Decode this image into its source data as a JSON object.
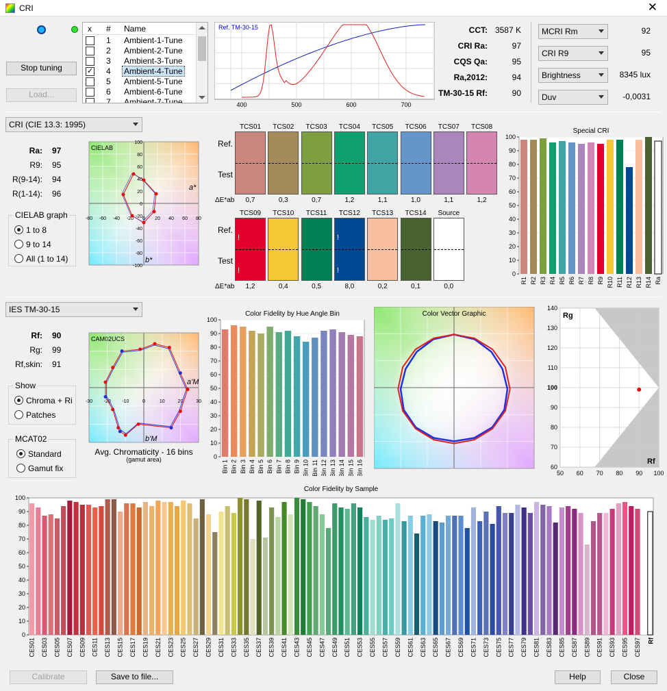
{
  "window": {
    "title": "CRI",
    "close": "✕"
  },
  "top": {
    "stop_tuning": "Stop tuning",
    "load": "Load...",
    "list_headers": [
      "x",
      "#",
      "Name"
    ],
    "list": [
      {
        "n": "1",
        "name": "Ambient-1-Tune",
        "checked": false
      },
      {
        "n": "2",
        "name": "Ambient-2-Tune",
        "checked": false
      },
      {
        "n": "3",
        "name": "Ambient-3-Tune",
        "checked": false
      },
      {
        "n": "4",
        "name": "Ambient-4-Tune",
        "checked": true,
        "selected": true
      },
      {
        "n": "5",
        "name": "Ambient-5-Tune",
        "checked": false
      },
      {
        "n": "6",
        "name": "Ambient-6-Tune",
        "checked": false
      },
      {
        "n": "7",
        "name": "Ambient-7-Tune",
        "checked": false
      }
    ],
    "spectrum_label": "Ref. TM-30-15",
    "spectrum_ticks": [
      "400",
      "500",
      "600",
      "700"
    ],
    "metrics": [
      {
        "label": "CCT:",
        "value": "3587 K"
      },
      {
        "label": "CRI Ra:",
        "value": "97"
      },
      {
        "label": "CQS Qa:",
        "value": "95"
      },
      {
        "label": "Ra,2012:",
        "value": "94"
      },
      {
        "label": "TM-30-15 Rf:",
        "value": "90"
      }
    ],
    "drop_metrics": [
      {
        "label": "MCRI Rm",
        "value": "92"
      },
      {
        "label": "CRI R9",
        "value": "95"
      },
      {
        "label": "Brightness",
        "value": "8345 lux"
      },
      {
        "label": "Duv",
        "value": "-0,0031"
      }
    ]
  },
  "cri": {
    "mode": "CRI (CIE 13.3: 1995)",
    "rows": [
      {
        "label": "Ra:",
        "value": "97"
      },
      {
        "label": "R9:",
        "value": "95"
      },
      {
        "label": "R(9-14):",
        "value": "94"
      },
      {
        "label": "R(1-14):",
        "value": "96"
      }
    ],
    "graph_title": "CIELAB graph",
    "radios": [
      "1 to 8",
      "9 to 14",
      "All (1 to 14)"
    ],
    "radio_selected": 0,
    "plot_label": "CIELAB",
    "axis_a": "a*",
    "axis_b": "b*",
    "plot_ticks": [
      "-80",
      "-60",
      "-40",
      "-20",
      "0",
      "20",
      "40",
      "60",
      "80"
    ],
    "plot_yticks": [
      "100",
      "80",
      "60",
      "40",
      "20",
      "0",
      "-20",
      "-40",
      "-60",
      "-80",
      "-100"
    ],
    "ref_label": "Ref.",
    "test_label": "Test",
    "de_label": "ΔE*ab",
    "tcs_row1": [
      {
        "name": "TCS01",
        "de": "0,7",
        "color": "#c9877e"
      },
      {
        "name": "TCS02",
        "de": "0,3",
        "color": "#a58b5a"
      },
      {
        "name": "TCS03",
        "de": "0,7",
        "color": "#7e9e42"
      },
      {
        "name": "TCS04",
        "de": "1,2",
        "color": "#0fa071"
      },
      {
        "name": "TCS05",
        "de": "1,1",
        "color": "#3ea4a4"
      },
      {
        "name": "TCS06",
        "de": "1,0",
        "color": "#6496cc"
      },
      {
        "name": "TCS07",
        "de": "1,1",
        "color": "#ab86bc"
      },
      {
        "name": "TCS08",
        "de": "1,2",
        "color": "#d585b2"
      }
    ],
    "tcs_row2": [
      {
        "name": "TCS09",
        "de": "1,2",
        "color": "#e4002a",
        "mark": true
      },
      {
        "name": "TCS10",
        "de": "0,4",
        "color": "#f3c834"
      },
      {
        "name": "TCS11",
        "de": "0,5",
        "color": "#008057"
      },
      {
        "name": "TCS12",
        "de": "8,0",
        "color": "#004a94",
        "mark": true
      },
      {
        "name": "TCS13",
        "de": "0,2",
        "color": "#f8c0a0"
      },
      {
        "name": "TCS14",
        "de": "0,1",
        "color": "#486230"
      },
      {
        "name": "Source",
        "de": "0,0",
        "color": "#ffffff"
      }
    ],
    "special_title": "Special CRI",
    "special": {
      "labels": [
        "R1",
        "R2",
        "R3",
        "R4",
        "R5",
        "R6",
        "R7",
        "R8",
        "R9",
        "R10",
        "R11",
        "R12",
        "R13",
        "R14",
        "Ra"
      ],
      "values": [
        98,
        98,
        99,
        96,
        97,
        96,
        95,
        96,
        95,
        98,
        98,
        78,
        98,
        100,
        97
      ],
      "colors": [
        "#c9877e",
        "#a58b5a",
        "#7e9e42",
        "#0fa071",
        "#3ea4a4",
        "#6496cc",
        "#ab86bc",
        "#d585b2",
        "#e4002a",
        "#f3c834",
        "#008057",
        "#004a94",
        "#f8c0a0",
        "#486230",
        "#ffffff"
      ],
      "ylim": [
        0,
        100
      ],
      "yticks": [
        "0",
        "10",
        "20",
        "30",
        "40",
        "50",
        "60",
        "70",
        "80",
        "90",
        "100"
      ]
    }
  },
  "tm30": {
    "mode": "IES TM-30-15",
    "rows": [
      {
        "label": "Rf:",
        "value": "90"
      },
      {
        "label": "Rg:",
        "value": "99"
      },
      {
        "label": "Rf,skin:",
        "value": "91"
      }
    ],
    "show_title": "Show",
    "show_radios": [
      "Chroma + Ri",
      "Patches"
    ],
    "show_selected": 0,
    "mcat_title": "MCAT02",
    "mcat_radios": [
      "Standard",
      "Gamut fix"
    ],
    "mcat_selected": 0,
    "plot_label": "CAM02UCS",
    "axis_a": "a'M",
    "axis_b": "b'M",
    "plot_ticks": [
      "-30",
      "-20",
      "-10",
      "0",
      "10",
      "20",
      "30"
    ],
    "plot_caption": "Avg. Chromaticity - 16 bins",
    "plot_sub": "(gamut area)",
    "hue_title": "Color Fidelity by Hue Angle Bin",
    "hue": {
      "labels": [
        "Bin 1",
        "Bin 2",
        "Bin 3",
        "Bin 4",
        "Bin 5",
        "Bin 6",
        "Bin 7",
        "Bin 8",
        "Bin 9",
        "Bin 10",
        "Bin 11",
        "Bin 12",
        "Bin 13",
        "Bin 14",
        "Bin 15",
        "Bin 16"
      ],
      "values": [
        93,
        96,
        95,
        92,
        90,
        95,
        91,
        92,
        88,
        84,
        87,
        92,
        93,
        91,
        89,
        88
      ],
      "colors": [
        "#e07a6a",
        "#e98a5e",
        "#e8a059",
        "#c7a35a",
        "#a9ab63",
        "#7fae6e",
        "#58ab82",
        "#40a996",
        "#44a6ab",
        "#4a9cbc",
        "#5e8fbf",
        "#7a86c0",
        "#8f80bb",
        "#a47ab0",
        "#b777a3",
        "#c77689"
      ],
      "ylim": [
        0,
        100
      ],
      "yticks": [
        "0",
        "10",
        "20",
        "30",
        "40",
        "50",
        "60",
        "70",
        "80",
        "90",
        "100"
      ]
    },
    "cvg_title": "Color Vector Graphic",
    "rfrg": {
      "rg_label": "Rg",
      "rf_label": "Rf",
      "yticks": [
        "140",
        "130",
        "120",
        "110",
        "100",
        "90",
        "80",
        "70",
        "60"
      ],
      "xticks": [
        "50",
        "60",
        "70",
        "80",
        "90",
        "100"
      ],
      "point_rf": 90,
      "point_rg": 99
    }
  },
  "samples": {
    "title": "Color Fidelity by Sample",
    "yticks": [
      "0",
      "10",
      "20",
      "30",
      "40",
      "50",
      "60",
      "70",
      "80",
      "90",
      "100"
    ],
    "rf_label": "Rf",
    "values": [
      96,
      93,
      87,
      88,
      85,
      94,
      98,
      97,
      95,
      95,
      93,
      94,
      99,
      99,
      90,
      96,
      96,
      93,
      97,
      94,
      98,
      97,
      97,
      94,
      98,
      96,
      85,
      99,
      88,
      75,
      90,
      94,
      89,
      100,
      99,
      70,
      98,
      71,
      93,
      86,
      97,
      88,
      100,
      99,
      97,
      94,
      88,
      78,
      96,
      93,
      92,
      96,
      93,
      86,
      84,
      87,
      84,
      85,
      96,
      83,
      87,
      74,
      87,
      88,
      83,
      82,
      87,
      87,
      87,
      78,
      93,
      83,
      90,
      81,
      94,
      89,
      89,
      95,
      93,
      89,
      97,
      95,
      94,
      82,
      93,
      94,
      92,
      89,
      66,
      83,
      89,
      89,
      92,
      96,
      97,
      94,
      92,
      91
    ],
    "colors": [
      "#f09aa8",
      "#e77f94",
      "#d85a72",
      "#d9707a",
      "#c95a68",
      "#c44d5c",
      "#a01c38",
      "#c72e40",
      "#a83a3e",
      "#e05a50",
      "#e85f4e",
      "#d24a3d",
      "#b15a4c",
      "#8e5a4a",
      "#f0a88e",
      "#d8744c",
      "#e07a3c",
      "#c96a2c",
      "#e6b47e",
      "#f0b26a",
      "#eea75a",
      "#f8c890",
      "#e8b050",
      "#e8a840",
      "#f2c870",
      "#e0c070",
      "#c8b078",
      "#6e6040",
      "#f4d48c",
      "#8e8060",
      "#f0e494",
      "#c8c070",
      "#c8c850",
      "#8e9030",
      "#747830",
      "#e0e0b8",
      "#546428",
      "#b8c4a0",
      "#7c9450",
      "#b8d4a0",
      "#48882c",
      "#d0e4b8",
      "#3a8c3a",
      "#207c34",
      "#3ea050",
      "#60a870",
      "#88c898",
      "#58a878",
      "#3a9c68",
      "#1f9060",
      "#60b890",
      "#40a080",
      "#108058",
      "#48b09c",
      "#a0dcd0",
      "#80d0c4",
      "#48b0a8",
      "#70c8c4",
      "#a8e0e0",
      "#3898a0",
      "#88cce0",
      "#1c5c70",
      "#5ab0d0",
      "#90c8e0",
      "#184c80",
      "#5a9cd0",
      "#78a8d4",
      "#5070b4",
      "#5a8cd4",
      "#2050a0",
      "#a0b4dc",
      "#4060b8",
      "#5c70b4",
      "#2c48a0",
      "#4858b0",
      "#8080c4",
      "#384090",
      "#b4b8e4",
      "#40308c",
      "#6a4ca0",
      "#cab4e0",
      "#8264a8",
      "#a878c4",
      "#562a70",
      "#c48ccc",
      "#a0408c",
      "#8a2c7c",
      "#d894c8",
      "#d8b4cc",
      "#b0548c",
      "#b4588e",
      "#f0b4d4",
      "#c43c7c",
      "#e4a0c0",
      "#e45888",
      "#c01c60",
      "#d04a78",
      "#ffffff"
    ]
  },
  "bottom": {
    "calibrate": "Calibrate",
    "save": "Save to file...",
    "help": "Help",
    "close": "Close"
  }
}
